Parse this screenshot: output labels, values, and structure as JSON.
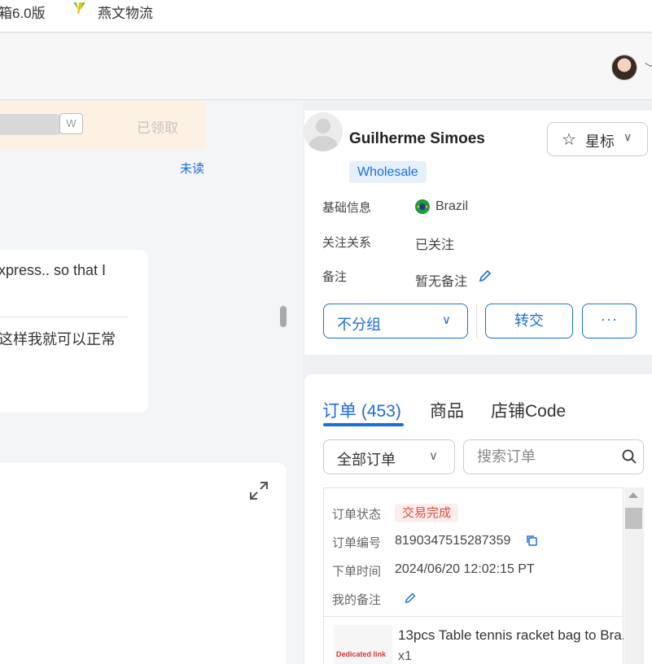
{
  "bookmarks": [
    {
      "label": "箱6.0版"
    },
    {
      "label": "燕文物流",
      "icon": "yanwen-logo-icon"
    }
  ],
  "chat": {
    "coupon": {
      "tag": "W",
      "status": "已领取"
    },
    "unread_label": "未读",
    "message": {
      "text_en": "xpress.. so that I",
      "text_zh": "这样我就可以正常"
    }
  },
  "profile": {
    "name": "Guilherme Simoes",
    "star_button": "星标",
    "tag": "Wholesale",
    "fields": {
      "basic_label": "基础信息",
      "country": "Brazil",
      "relation_label": "关注关系",
      "relation_value": "已关注",
      "note_label": "备注",
      "note_value": "暂无备注"
    },
    "group_select": "不分组",
    "transfer_button": "转交",
    "more_button": "···"
  },
  "orders": {
    "tabs": [
      "订单 (453)",
      "商品",
      "店铺Code"
    ],
    "active_tab": 0,
    "filter": "全部订单",
    "search_placeholder": "搜索订单",
    "order": {
      "status_label": "订单状态",
      "status_value": "交易完成",
      "number_label": "订单编号",
      "number_value": "8190347515287359",
      "time_label": "下单时间",
      "time_value": "2024/06/20 12:02:15 PT",
      "remark_label": "我的备注",
      "product": {
        "thumb_text": "Dedicated link",
        "title": "13pcs Table tennis racket bag to Bra...",
        "qty": "x1"
      }
    }
  },
  "colors": {
    "accent": "#1a6ed8",
    "status_red": "#e14a3b",
    "coupon_bg": "#fdf1e3"
  }
}
